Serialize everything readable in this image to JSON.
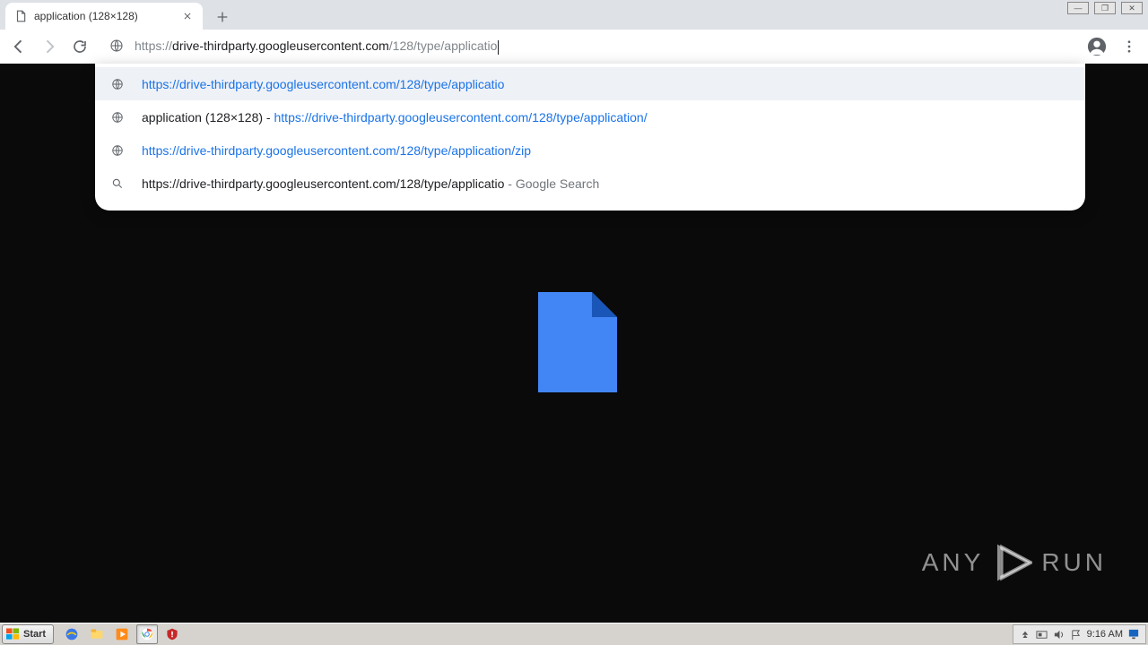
{
  "browser": {
    "tab_title": "application (128×128)",
    "address_prefix": "https://",
    "address_host": "drive-thirdparty.googleusercontent.com",
    "address_path": "/128/type/applicatio"
  },
  "suggestions": [
    {
      "type": "url",
      "text": "https://drive-thirdparty.googleusercontent.com/128/type/applicatio",
      "highlighted": true
    },
    {
      "type": "history",
      "title": "application (128×128)",
      "sep": " - ",
      "url_bold": "https://drive-thirdparty.googleusercontent.com/128/type/applicatio",
      "url_tail": "n/"
    },
    {
      "type": "history2",
      "url_bold": "https://drive-thirdparty.googleusercontent.com/128/type/applicatio",
      "url_tail": "n/zip"
    },
    {
      "type": "search",
      "query": "https://drive-thirdparty.googleusercontent.com/128/type/applicatio",
      "engine": " - Google Search"
    }
  ],
  "watermark": {
    "left": "ANY",
    "right": "RUN"
  },
  "taskbar": {
    "start": "Start",
    "time": "9:16 AM"
  }
}
